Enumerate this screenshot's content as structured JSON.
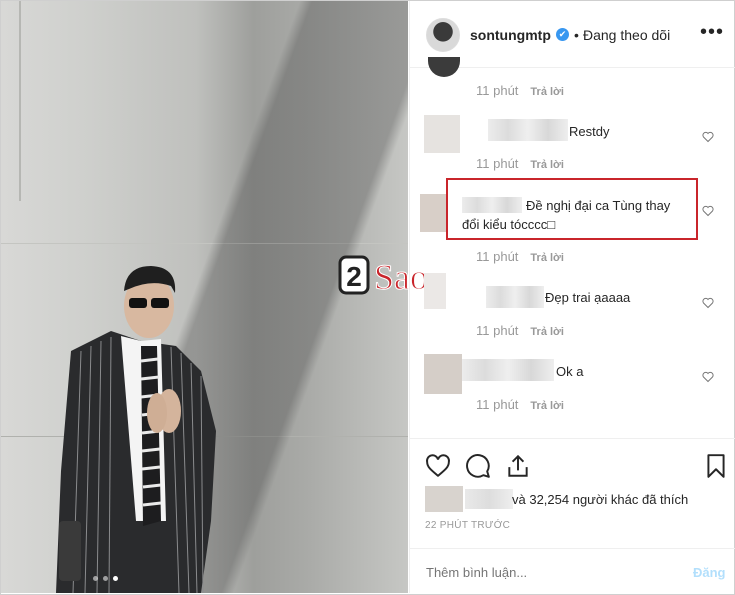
{
  "header": {
    "username": "sontungmtp",
    "verified_mark": "✔",
    "separator": "•",
    "follow_label": "Đang theo dõi",
    "more_label": "•••"
  },
  "comments": [
    {
      "text": "",
      "time": "11 phút",
      "reply": "Trả lời"
    },
    {
      "text": "Restdy",
      "time": "11 phút",
      "reply": "Trả lời"
    },
    {
      "text": "Đề nghị đại ca Tùng thay",
      "text2": "đổi kiểu tócccc□",
      "time": "11 phút",
      "reply": "Trả lời"
    },
    {
      "text": "Đẹp trai ạaaaa",
      "time": "11 phút",
      "reply": "Trả lời"
    },
    {
      "text": "Ok a",
      "time": "11 phút",
      "reply": "Trả lời"
    }
  ],
  "watermark": {
    "number": "2",
    "text": "Sao"
  },
  "actions": {
    "icons": [
      "heart-icon",
      "comment-icon",
      "share-icon",
      "bookmark-icon"
    ]
  },
  "likes_text": "và 32,254 người khác đã thích",
  "timestamp": "22 PHÚT TRƯỚC",
  "add_comment": {
    "placeholder": "Thêm bình luận...",
    "post_label": "Đăng"
  },
  "carousel": {
    "total": 3,
    "active": 3
  },
  "colors": {
    "highlight": "#c9252b",
    "verified": "#3897f0",
    "post_disabled": "#b2dffc"
  }
}
